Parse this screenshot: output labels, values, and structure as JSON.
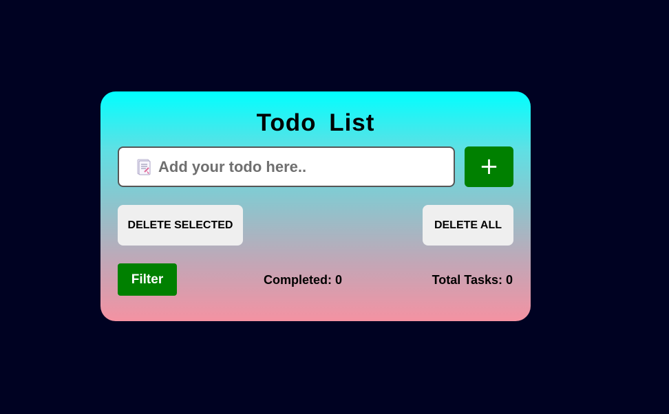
{
  "app": {
    "title": "Todo  List"
  },
  "input": {
    "placeholder": "Add your todo here..",
    "value": "",
    "icon": "note-icon"
  },
  "buttons": {
    "add_label": "+",
    "delete_selected_label": "DELETE SELECTED",
    "delete_all_label": "DELETE ALL",
    "filter_label": "Filter"
  },
  "stats": {
    "completed_text": "Completed: 0",
    "total_text": "Total Tasks: 0"
  },
  "colors": {
    "background": "#000222",
    "accent_green": "#008000",
    "gradient_top": "#00ffff",
    "gradient_bottom": "#f492a2",
    "gray_button": "#efefef"
  }
}
